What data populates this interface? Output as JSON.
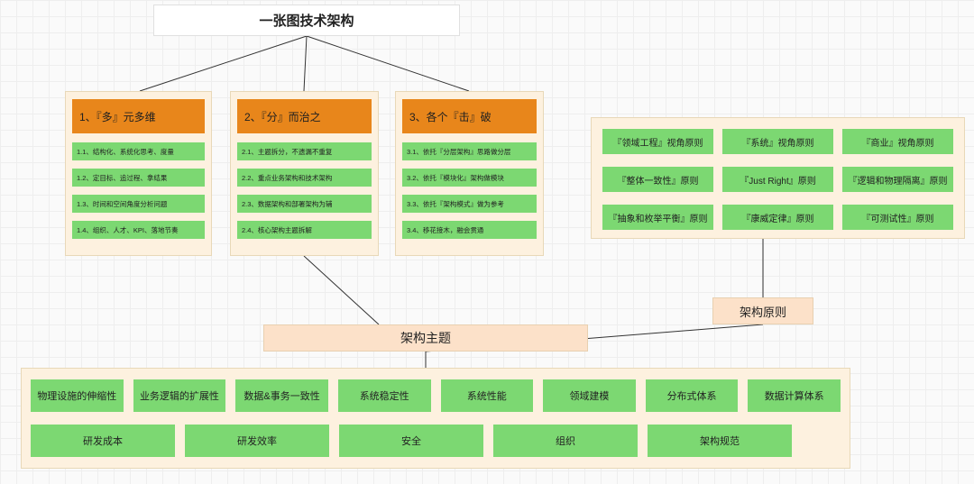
{
  "root": {
    "title": "一张图技术架构"
  },
  "branches": [
    {
      "header": "1、『多』元多维",
      "items": [
        "1.1、结构化、系统化思考、度量",
        "1.2、定目标、追过程、拿结果",
        "1.3、时间和空间角度分析问题",
        "1.4、组织、人才、KPI、落地节奏"
      ]
    },
    {
      "header": "2、『分』而治之",
      "items": [
        "2.1、主题拆分，不遗漏不重复",
        "2.2、重点业务架构和技术架构",
        "2.3、数据架构和部署架构为辅",
        "2.4、核心架构主题拆解"
      ]
    },
    {
      "header": "3、各个『击』破",
      "items": [
        "3.1、依托『分层架构』思路做分层",
        "3.2、依托『模块化』架构做模块",
        "3.3、依托『架构模式』做为参考",
        "3.4、移花接木，融会贯通"
      ]
    }
  ],
  "theme": {
    "label": "架构主题",
    "row1": [
      "物理设施的伸缩性",
      "业务逻辑的扩展性",
      "数据&事务一致性",
      "系统稳定性",
      "系统性能",
      "领域建模",
      "分布式体系",
      "数据计算体系"
    ],
    "row2": [
      "研发成本",
      "研发效率",
      "安全",
      "组织",
      "架构规范"
    ]
  },
  "principles": {
    "label": "架构原则",
    "row1": [
      "『领域工程』视角原则",
      "『系统』视角原则",
      "『商业』视角原则"
    ],
    "row2": [
      "『整体一致性』原则",
      "『Just Right』原则",
      "『逻辑和物理隔离』原则"
    ],
    "row3": [
      "『抽象和枚举平衡』原则",
      "『康威定律』原则",
      "『可测试性』原则"
    ]
  },
  "colors": {
    "group_bg": "#fdf1df",
    "header_bg": "#e8861b",
    "item_bg": "#7cd872",
    "label_bg": "#fce1c9"
  }
}
